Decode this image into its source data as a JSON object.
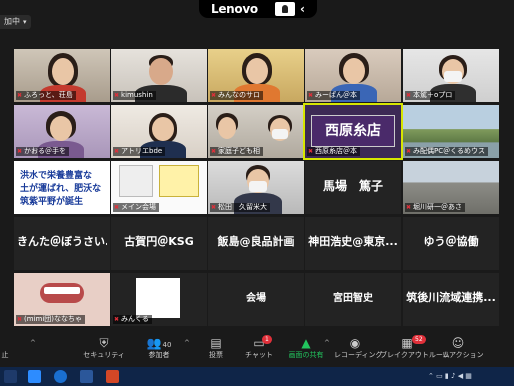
{
  "top": {
    "recording_label": "加中",
    "brand": "Lenovo"
  },
  "tiles": {
    "t1": "ふろっと、荘島",
    "t2": "kimushin",
    "t3": "みんなのサロ",
    "t4": "みーぱん＠本",
    "t5": "本駕＋oプロ",
    "t6": "かおる＠手を",
    "t7": "アトリエbde",
    "t8": "家庭子ども相",
    "t9": "西原糸店＠本",
    "t10": "み配偶PC＠くるめウス",
    "t11": "",
    "t12": "メイン会場",
    "t13": "松田　久留米大",
    "t14": "馬場　篤子",
    "t15": "堀川研一＠あさ",
    "t16": "きんた＠ぼうさい...",
    "t17": "古賀円＠KSG",
    "t18": "飯島@良品計画",
    "t19": "神田浩史@東京...",
    "t20": "ゆう＠協働",
    "t21": "(mimi団)ななちゃ",
    "t22": "みんくる",
    "t23": "会場",
    "t24": "宮田智史",
    "t25": "筑後川流域連携..."
  },
  "signs": {
    "nishihara": "西原糸店",
    "doc_line1": "洪水で栄養豊富な",
    "doc_line2": "土が運ばれ、肥沃な",
    "doc_line3": "筑紫平野が誕生"
  },
  "toolbar": {
    "security": "セキュリティ",
    "participants": "参加者",
    "participants_count": "40",
    "poll": "投票",
    "chat": "チャット",
    "chat_badge": "1",
    "share": "画面の共有",
    "record": "レコーディング",
    "breakout": "ブレイクアウトルーム",
    "breakout_badge": "52",
    "reactions": "リアクション",
    "left_cut": "止"
  },
  "colors": {
    "active_speaker": "#d7e600",
    "share_green": "#22c55e",
    "mic_muted": "#e0303a"
  }
}
